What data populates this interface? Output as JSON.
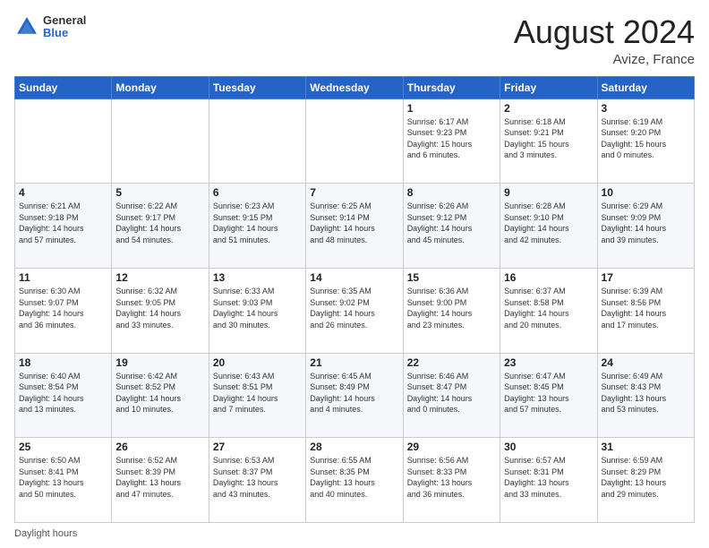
{
  "header": {
    "logo_general": "General",
    "logo_blue": "Blue",
    "main_title": "August 2024",
    "subtitle": "Avize, France"
  },
  "days_of_week": [
    "Sunday",
    "Monday",
    "Tuesday",
    "Wednesday",
    "Thursday",
    "Friday",
    "Saturday"
  ],
  "weeks": [
    [
      {
        "num": "",
        "info": ""
      },
      {
        "num": "",
        "info": ""
      },
      {
        "num": "",
        "info": ""
      },
      {
        "num": "",
        "info": ""
      },
      {
        "num": "1",
        "info": "Sunrise: 6:17 AM\nSunset: 9:23 PM\nDaylight: 15 hours\nand 6 minutes."
      },
      {
        "num": "2",
        "info": "Sunrise: 6:18 AM\nSunset: 9:21 PM\nDaylight: 15 hours\nand 3 minutes."
      },
      {
        "num": "3",
        "info": "Sunrise: 6:19 AM\nSunset: 9:20 PM\nDaylight: 15 hours\nand 0 minutes."
      }
    ],
    [
      {
        "num": "4",
        "info": "Sunrise: 6:21 AM\nSunset: 9:18 PM\nDaylight: 14 hours\nand 57 minutes."
      },
      {
        "num": "5",
        "info": "Sunrise: 6:22 AM\nSunset: 9:17 PM\nDaylight: 14 hours\nand 54 minutes."
      },
      {
        "num": "6",
        "info": "Sunrise: 6:23 AM\nSunset: 9:15 PM\nDaylight: 14 hours\nand 51 minutes."
      },
      {
        "num": "7",
        "info": "Sunrise: 6:25 AM\nSunset: 9:14 PM\nDaylight: 14 hours\nand 48 minutes."
      },
      {
        "num": "8",
        "info": "Sunrise: 6:26 AM\nSunset: 9:12 PM\nDaylight: 14 hours\nand 45 minutes."
      },
      {
        "num": "9",
        "info": "Sunrise: 6:28 AM\nSunset: 9:10 PM\nDaylight: 14 hours\nand 42 minutes."
      },
      {
        "num": "10",
        "info": "Sunrise: 6:29 AM\nSunset: 9:09 PM\nDaylight: 14 hours\nand 39 minutes."
      }
    ],
    [
      {
        "num": "11",
        "info": "Sunrise: 6:30 AM\nSunset: 9:07 PM\nDaylight: 14 hours\nand 36 minutes."
      },
      {
        "num": "12",
        "info": "Sunrise: 6:32 AM\nSunset: 9:05 PM\nDaylight: 14 hours\nand 33 minutes."
      },
      {
        "num": "13",
        "info": "Sunrise: 6:33 AM\nSunset: 9:03 PM\nDaylight: 14 hours\nand 30 minutes."
      },
      {
        "num": "14",
        "info": "Sunrise: 6:35 AM\nSunset: 9:02 PM\nDaylight: 14 hours\nand 26 minutes."
      },
      {
        "num": "15",
        "info": "Sunrise: 6:36 AM\nSunset: 9:00 PM\nDaylight: 14 hours\nand 23 minutes."
      },
      {
        "num": "16",
        "info": "Sunrise: 6:37 AM\nSunset: 8:58 PM\nDaylight: 14 hours\nand 20 minutes."
      },
      {
        "num": "17",
        "info": "Sunrise: 6:39 AM\nSunset: 8:56 PM\nDaylight: 14 hours\nand 17 minutes."
      }
    ],
    [
      {
        "num": "18",
        "info": "Sunrise: 6:40 AM\nSunset: 8:54 PM\nDaylight: 14 hours\nand 13 minutes."
      },
      {
        "num": "19",
        "info": "Sunrise: 6:42 AM\nSunset: 8:52 PM\nDaylight: 14 hours\nand 10 minutes."
      },
      {
        "num": "20",
        "info": "Sunrise: 6:43 AM\nSunset: 8:51 PM\nDaylight: 14 hours\nand 7 minutes."
      },
      {
        "num": "21",
        "info": "Sunrise: 6:45 AM\nSunset: 8:49 PM\nDaylight: 14 hours\nand 4 minutes."
      },
      {
        "num": "22",
        "info": "Sunrise: 6:46 AM\nSunset: 8:47 PM\nDaylight: 14 hours\nand 0 minutes."
      },
      {
        "num": "23",
        "info": "Sunrise: 6:47 AM\nSunset: 8:45 PM\nDaylight: 13 hours\nand 57 minutes."
      },
      {
        "num": "24",
        "info": "Sunrise: 6:49 AM\nSunset: 8:43 PM\nDaylight: 13 hours\nand 53 minutes."
      }
    ],
    [
      {
        "num": "25",
        "info": "Sunrise: 6:50 AM\nSunset: 8:41 PM\nDaylight: 13 hours\nand 50 minutes."
      },
      {
        "num": "26",
        "info": "Sunrise: 6:52 AM\nSunset: 8:39 PM\nDaylight: 13 hours\nand 47 minutes."
      },
      {
        "num": "27",
        "info": "Sunrise: 6:53 AM\nSunset: 8:37 PM\nDaylight: 13 hours\nand 43 minutes."
      },
      {
        "num": "28",
        "info": "Sunrise: 6:55 AM\nSunset: 8:35 PM\nDaylight: 13 hours\nand 40 minutes."
      },
      {
        "num": "29",
        "info": "Sunrise: 6:56 AM\nSunset: 8:33 PM\nDaylight: 13 hours\nand 36 minutes."
      },
      {
        "num": "30",
        "info": "Sunrise: 6:57 AM\nSunset: 8:31 PM\nDaylight: 13 hours\nand 33 minutes."
      },
      {
        "num": "31",
        "info": "Sunrise: 6:59 AM\nSunset: 8:29 PM\nDaylight: 13 hours\nand 29 minutes."
      }
    ]
  ],
  "footer": {
    "daylight_label": "Daylight hours"
  }
}
